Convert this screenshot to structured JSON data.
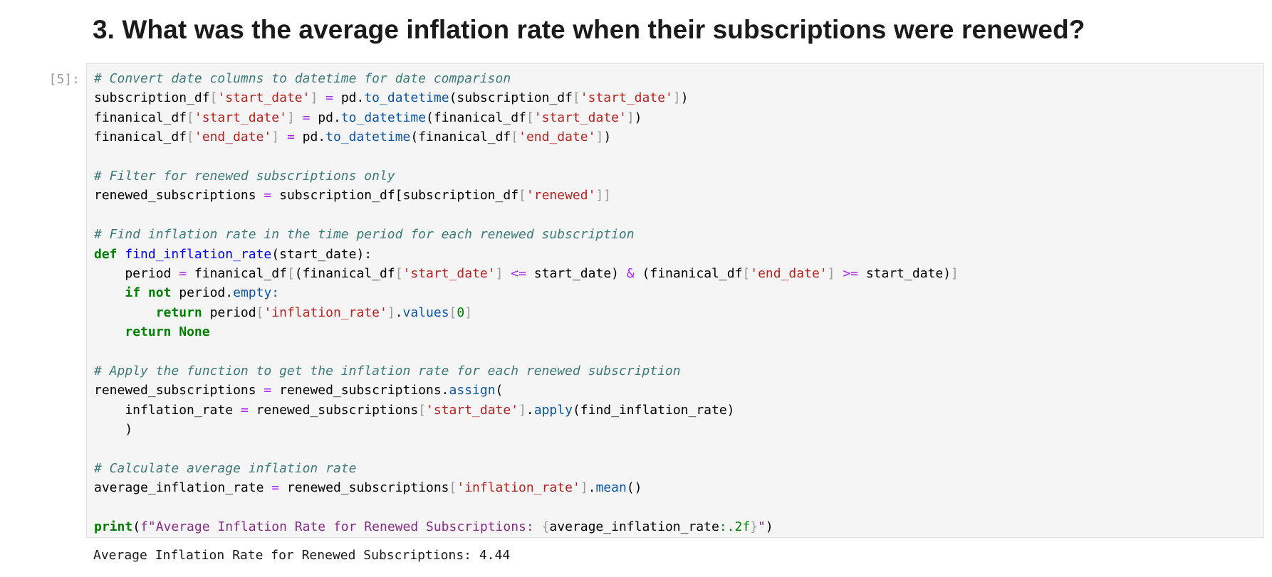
{
  "heading": "3. What was the average inflation rate when their subscriptions were renewed?",
  "cell": {
    "prompt": "[5]:",
    "code_lines": [
      [
        [
          "comment",
          "# Convert date columns to datetime for date comparison"
        ]
      ],
      [
        [
          "name",
          "subscription_df"
        ],
        [
          "bracket",
          "["
        ],
        [
          "string",
          "'start_date'"
        ],
        [
          "bracket",
          "]"
        ],
        [
          "name",
          " "
        ],
        [
          "op",
          "="
        ],
        [
          "name",
          " pd."
        ],
        [
          "attr",
          "to_datetime"
        ],
        [
          "name",
          "(subscription_df"
        ],
        [
          "bracket",
          "["
        ],
        [
          "string",
          "'start_date'"
        ],
        [
          "bracket",
          "]"
        ],
        [
          "name",
          ")"
        ]
      ],
      [
        [
          "name",
          "finanical_df"
        ],
        [
          "bracket",
          "["
        ],
        [
          "string",
          "'start_date'"
        ],
        [
          "bracket",
          "]"
        ],
        [
          "name",
          " "
        ],
        [
          "op",
          "="
        ],
        [
          "name",
          " pd."
        ],
        [
          "attr",
          "to_datetime"
        ],
        [
          "name",
          "(finanical_df"
        ],
        [
          "bracket",
          "["
        ],
        [
          "string",
          "'start_date'"
        ],
        [
          "bracket",
          "]"
        ],
        [
          "name",
          ")"
        ]
      ],
      [
        [
          "name",
          "finanical_df"
        ],
        [
          "bracket",
          "["
        ],
        [
          "string",
          "'end_date'"
        ],
        [
          "bracket",
          "]"
        ],
        [
          "name",
          " "
        ],
        [
          "op",
          "="
        ],
        [
          "name",
          " pd."
        ],
        [
          "attr",
          "to_datetime"
        ],
        [
          "name",
          "(finanical_df"
        ],
        [
          "bracket",
          "["
        ],
        [
          "string",
          "'end_date'"
        ],
        [
          "bracket",
          "]"
        ],
        [
          "name",
          ")"
        ]
      ],
      [],
      [
        [
          "comment",
          "# Filter for renewed subscriptions only"
        ]
      ],
      [
        [
          "name",
          "renewed_subscriptions "
        ],
        [
          "op",
          "="
        ],
        [
          "name",
          " subscription_df[subscription_df"
        ],
        [
          "bracket",
          "["
        ],
        [
          "string",
          "'renewed'"
        ],
        [
          "bracket",
          "]]"
        ]
      ],
      [],
      [
        [
          "comment",
          "# Find inflation rate in the time period for each renewed subscription"
        ]
      ],
      [
        [
          "keyword",
          "def"
        ],
        [
          "name",
          " "
        ],
        [
          "func",
          "find_inflation_rate"
        ],
        [
          "name",
          "(start_date):"
        ]
      ],
      [
        [
          "name",
          "    period "
        ],
        [
          "op",
          "="
        ],
        [
          "name",
          " finanical_df"
        ],
        [
          "bracket",
          "["
        ],
        [
          "name",
          "(finanical_df"
        ],
        [
          "bracket",
          "["
        ],
        [
          "string",
          "'start_date'"
        ],
        [
          "bracket",
          "]"
        ],
        [
          "name",
          " "
        ],
        [
          "op",
          "<="
        ],
        [
          "name",
          " start_date) "
        ],
        [
          "op",
          "&"
        ],
        [
          "name",
          " (finanical_df"
        ],
        [
          "bracket",
          "["
        ],
        [
          "string",
          "'end_date'"
        ],
        [
          "bracket",
          "]"
        ],
        [
          "name",
          " "
        ],
        [
          "op",
          ">="
        ],
        [
          "name",
          " start_date)"
        ],
        [
          "bracket",
          "]"
        ]
      ],
      [
        [
          "name",
          "    "
        ],
        [
          "keyword",
          "if"
        ],
        [
          "name",
          " "
        ],
        [
          "keyword",
          "not"
        ],
        [
          "name",
          " period."
        ],
        [
          "attr",
          "empty:"
        ]
      ],
      [
        [
          "name",
          "        "
        ],
        [
          "keyword",
          "return"
        ],
        [
          "name",
          " period"
        ],
        [
          "bracket",
          "["
        ],
        [
          "string",
          "'inflation_rate'"
        ],
        [
          "bracket",
          "]"
        ],
        [
          "name",
          "."
        ],
        [
          "attr",
          "values"
        ],
        [
          "bracket",
          "["
        ],
        [
          "number",
          "0"
        ],
        [
          "bracket",
          "]"
        ]
      ],
      [
        [
          "name",
          "    "
        ],
        [
          "keyword",
          "return"
        ],
        [
          "name",
          " "
        ],
        [
          "keyword",
          "None"
        ]
      ],
      [],
      [
        [
          "comment",
          "# Apply the function to get the inflation rate for each renewed subscription"
        ]
      ],
      [
        [
          "name",
          "renewed_subscriptions "
        ],
        [
          "op",
          "="
        ],
        [
          "name",
          " renewed_subscriptions."
        ],
        [
          "attr",
          "assign"
        ],
        [
          "name",
          "("
        ]
      ],
      [
        [
          "name",
          "    inflation_rate "
        ],
        [
          "op",
          "="
        ],
        [
          "name",
          " renewed_subscriptions"
        ],
        [
          "bracket",
          "["
        ],
        [
          "string",
          "'start_date'"
        ],
        [
          "bracket",
          "]"
        ],
        [
          "name",
          "."
        ],
        [
          "attr",
          "apply"
        ],
        [
          "name",
          "(find_inflation_rate)"
        ]
      ],
      [
        [
          "name",
          "    )"
        ]
      ],
      [],
      [
        [
          "comment",
          "# Calculate average inflation rate"
        ]
      ],
      [
        [
          "name",
          "average_inflation_rate "
        ],
        [
          "op",
          "="
        ],
        [
          "name",
          " renewed_subscriptions"
        ],
        [
          "bracket",
          "["
        ],
        [
          "string",
          "'inflation_rate'"
        ],
        [
          "bracket",
          "]"
        ],
        [
          "name",
          "."
        ],
        [
          "attr",
          "mean"
        ],
        [
          "name",
          "()"
        ]
      ],
      [],
      [
        [
          "keyword",
          "print"
        ],
        [
          "name",
          "("
        ],
        [
          "fstring",
          "f\"Average Inflation Rate for Renewed Subscriptions: "
        ],
        [
          "bracket",
          "{"
        ],
        [
          "name",
          "average_inflation_rate"
        ],
        [
          "fmt",
          ":.2f"
        ],
        [
          "bracket",
          "}"
        ],
        [
          "fstring",
          "\""
        ],
        [
          "name",
          ")"
        ]
      ]
    ],
    "output": "Average Inflation Rate for Renewed Subscriptions: 4.44"
  }
}
